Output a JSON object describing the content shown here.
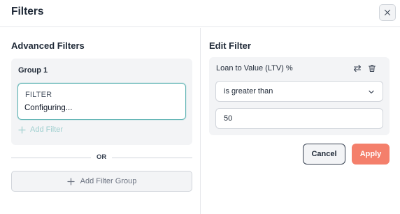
{
  "header": {
    "title": "Filters"
  },
  "left": {
    "section_title": "Advanced Filters",
    "group": {
      "label": "Group 1",
      "filter_card": {
        "label": "FILTER",
        "status": "Configuring..."
      },
      "add_filter_label": "Add Filter"
    },
    "or_label": "OR",
    "add_group_label": "Add Filter Group"
  },
  "right": {
    "section_title": "Edit Filter",
    "field_label": "Loan to Value (LTV) %",
    "operator": "is greater than",
    "value": "50",
    "cancel_label": "Cancel",
    "apply_label": "Apply"
  },
  "icons": {
    "close": "close-icon",
    "swap": "swap-icon",
    "delete": "trash-icon",
    "chevron": "chevron-down-icon",
    "plus": "plus-icon"
  },
  "colors": {
    "accent_teal": "#5eb3b3",
    "apply": "#f47f6b",
    "panel_bg": "#f3f4f6"
  }
}
